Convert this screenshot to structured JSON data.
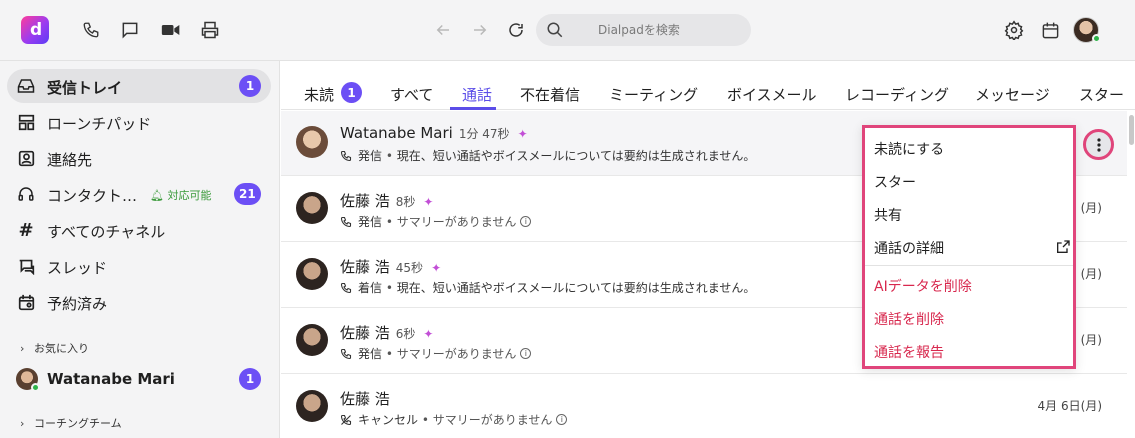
{
  "topbar": {
    "search_placeholder": "Dialpadを検索",
    "icons": [
      "phone-icon",
      "chat-icon",
      "video-icon",
      "printer-icon",
      "back-arrow-icon",
      "forward-arrow-icon",
      "refresh-icon",
      "search-icon",
      "gear-icon",
      "calendar-icon"
    ]
  },
  "sidebar": {
    "inbox": {
      "label": "受信トレイ",
      "count": "1"
    },
    "launchpad": {
      "label": "ローンチパッド"
    },
    "contacts": {
      "label": "連絡先"
    },
    "contact_center": {
      "label": "コンタクト…",
      "status": "対応可能",
      "count": "21"
    },
    "channels": {
      "label": "すべてのチャネル"
    },
    "threads": {
      "label": "スレッド"
    },
    "scheduled": {
      "label": "予約済み"
    },
    "favorites_header": "お気に入り",
    "favorite_user": {
      "name": "Watanabe Mari",
      "count": "1"
    },
    "coaching_header": "コーチングチーム"
  },
  "tabs": {
    "unread": "未読",
    "unread_count": "1",
    "all": "すべて",
    "calls": "通話",
    "missed": "不在着信",
    "meetings": "ミーティング",
    "voicemail": "ボイスメール",
    "recordings": "レコーディング",
    "messages": "メッセージ",
    "starred": "スター"
  },
  "rows": [
    {
      "name": "Watanabe Mari",
      "duration": "1分 47秒",
      "direction": "発信",
      "summary": "現在、短い通話やボイスメールについては要約は生成されません。",
      "date": ""
    },
    {
      "name": "佐藤 浩",
      "duration": "8秒",
      "direction": "発信",
      "summary": "サマリーがありません",
      "date": "(月)"
    },
    {
      "name": "佐藤 浩",
      "duration": "45秒",
      "direction": "着信",
      "summary": "現在、短い通話やボイスメールについては要約は生成されません。",
      "date": "(月)"
    },
    {
      "name": "佐藤 浩",
      "duration": "6秒",
      "direction": "発信",
      "summary": "サマリーがありません",
      "date": "(月)"
    },
    {
      "name": "佐藤 浩",
      "duration": "",
      "direction": "キャンセル",
      "summary": "サマリーがありません",
      "date": "4月 6日(月)"
    }
  ],
  "menu": {
    "mark_unread": "未読にする",
    "star": "スター",
    "share": "共有",
    "call_details": "通話の詳細",
    "delete_ai": "AIデータを削除",
    "delete_call": "通話を削除",
    "report_call": "通話を報告"
  },
  "colors": {
    "accent": "#5b4de8",
    "badge": "#6c4ff5",
    "danger": "#d8284e",
    "highlight": "#e0457b",
    "available": "#3a9a3a"
  }
}
